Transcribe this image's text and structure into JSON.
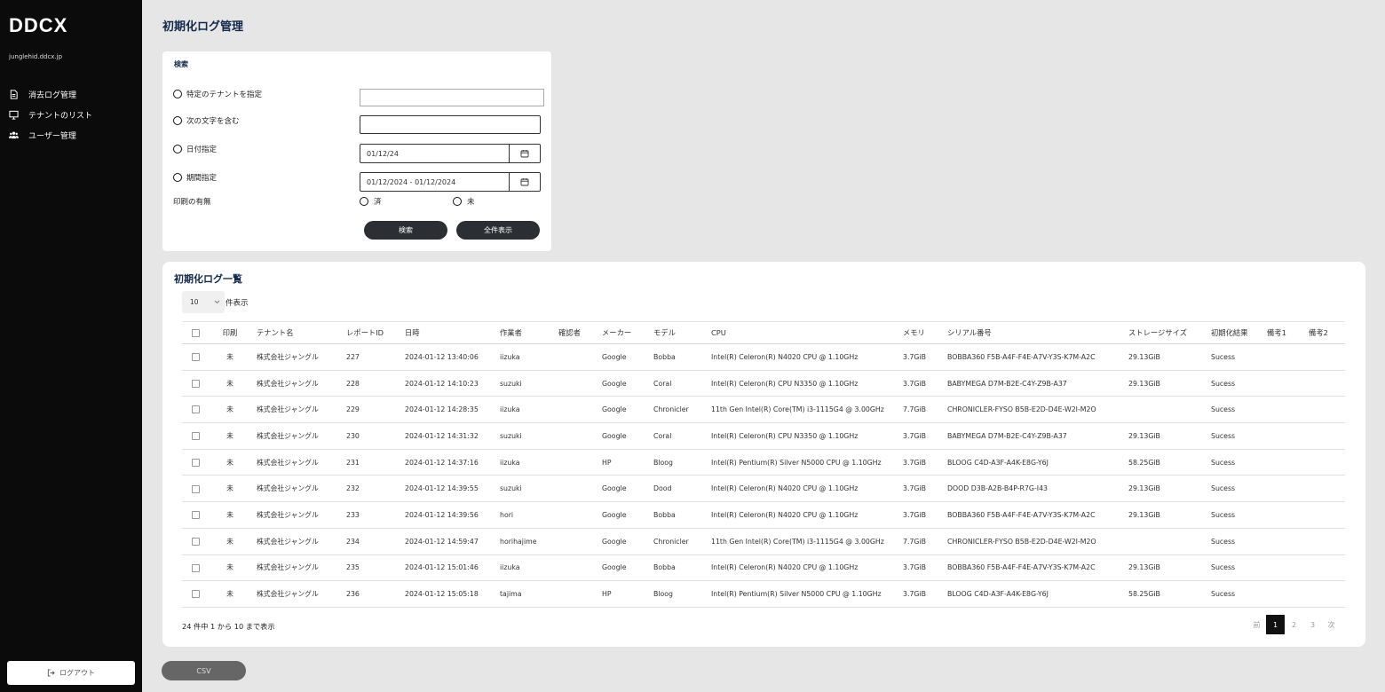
{
  "sidebar": {
    "logo": "DDCX",
    "email": "junglehid.ddcx.jp",
    "items": [
      {
        "label": "消去ログ管理",
        "icon": "document-icon"
      },
      {
        "label": "テナントのリスト",
        "icon": "monitor-icon"
      },
      {
        "label": "ユーザー管理",
        "icon": "users-icon"
      }
    ],
    "logout_label": "ログアウト"
  },
  "page_title": "初期化ログ管理",
  "search": {
    "heading": "検索",
    "options": {
      "tenant": "特定のテナントを指定",
      "contains": "次の文字を含む",
      "date": "日付指定",
      "period": "期間指定"
    },
    "tenant_value": "",
    "contains_value": "",
    "date_value": "01/12/24",
    "period_value": "01/12/2024 - 01/12/2024",
    "print_label": "印刷の有無",
    "print_done": "済",
    "print_not": "未",
    "search_button": "検索",
    "show_all_button": "全件表示"
  },
  "list": {
    "title": "初期化ログ一覧",
    "per_page": "10",
    "per_page_label": "件表示",
    "columns": [
      "印刷",
      "テナント名",
      "レポートID",
      "日時",
      "作業者",
      "確認者",
      "メーカー",
      "モデル",
      "CPU",
      "メモリ",
      "シリアル番号",
      "ストレージサイズ",
      "初期化結果",
      "備考1",
      "備考2"
    ],
    "rows": [
      [
        "未",
        "株式会社ジャングル",
        "227",
        "2024-01-12 13:40:06",
        "iizuka",
        "",
        "Google",
        "Bobba",
        "Intel(R) Celeron(R) N4020 CPU @ 1.10GHz",
        "3.7GiB",
        "BOBBA360 F5B-A4F-F4E-A7V-Y3S-K7M-A2C",
        "29.13GiB",
        "Sucess",
        "",
        ""
      ],
      [
        "未",
        "株式会社ジャングル",
        "228",
        "2024-01-12 14:10:23",
        "suzuki",
        "",
        "Google",
        "Coral",
        "Intel(R) Celeron(R) CPU N3350 @ 1.10GHz",
        "3.7GiB",
        "BABYMEGA D7M-B2E-C4Y-Z9B-A37",
        "29.13GiB",
        "Sucess",
        "",
        ""
      ],
      [
        "未",
        "株式会社ジャングル",
        "229",
        "2024-01-12 14:28:35",
        "iizuka",
        "",
        "Google",
        "Chronicler",
        "11th Gen Intel(R) Core(TM) i3-1115G4 @ 3.00GHz",
        "7.7GiB",
        "CHRONICLER-FYSO B5B-E2D-D4E-W2I-M2O",
        "",
        "Sucess",
        "",
        ""
      ],
      [
        "未",
        "株式会社ジャングル",
        "230",
        "2024-01-12 14:31:32",
        "suzuki",
        "",
        "Google",
        "Coral",
        "Intel(R) Celeron(R) CPU N3350 @ 1.10GHz",
        "3.7GiB",
        "BABYMEGA D7M-B2E-C4Y-Z9B-A37",
        "29.13GiB",
        "Sucess",
        "",
        ""
      ],
      [
        "未",
        "株式会社ジャングル",
        "231",
        "2024-01-12 14:37:16",
        "iizuka",
        "",
        "HP",
        "Bloog",
        "Intel(R) Pentium(R) Silver N5000 CPU @ 1.10GHz",
        "3.7GiB",
        "BLOOG C4D-A3F-A4K-E8G-Y6J",
        "58.25GiB",
        "Sucess",
        "",
        ""
      ],
      [
        "未",
        "株式会社ジャングル",
        "232",
        "2024-01-12 14:39:55",
        "suzuki",
        "",
        "Google",
        "Dood",
        "Intel(R) Celeron(R) N4020 CPU @ 1.10GHz",
        "3.7GiB",
        "DOOD D3B-A2B-B4P-R7G-I43",
        "29.13GiB",
        "Sucess",
        "",
        ""
      ],
      [
        "未",
        "株式会社ジャングル",
        "233",
        "2024-01-12 14:39:56",
        "hori",
        "",
        "Google",
        "Bobba",
        "Intel(R) Celeron(R) N4020 CPU @ 1.10GHz",
        "3.7GiB",
        "BOBBA360 F5B-A4F-F4E-A7V-Y3S-K7M-A2C",
        "29.13GiB",
        "Sucess",
        "",
        ""
      ],
      [
        "未",
        "株式会社ジャングル",
        "234",
        "2024-01-12 14:59:47",
        "horihajime",
        "",
        "Google",
        "Chronicler",
        "11th Gen Intel(R) Core(TM) i3-1115G4 @ 3.00GHz",
        "7.7GiB",
        "CHRONICLER-FYSO B5B-E2D-D4E-W2I-M2O",
        "",
        "Sucess",
        "",
        ""
      ],
      [
        "未",
        "株式会社ジャングル",
        "235",
        "2024-01-12 15:01:46",
        "iizuka",
        "",
        "Google",
        "Bobba",
        "Intel(R) Celeron(R) N4020 CPU @ 1.10GHz",
        "3.7GiB",
        "BOBBA360 F5B-A4F-F4E-A7V-Y3S-K7M-A2C",
        "29.13GiB",
        "Sucess",
        "",
        ""
      ],
      [
        "未",
        "株式会社ジャングル",
        "236",
        "2024-01-12 15:05:18",
        "tajima",
        "",
        "HP",
        "Bloog",
        "Intel(R) Pentium(R) Silver N5000 CPU @ 1.10GHz",
        "3.7GiB",
        "BLOOG C4D-A3F-A4K-E8G-Y6J",
        "58.25GiB",
        "Sucess",
        "",
        ""
      ]
    ],
    "summary": "24 件中 1 から 10 まで表示",
    "pagination": {
      "prev": "前",
      "pages": [
        "1",
        "2",
        "3"
      ],
      "next": "次",
      "current": "1"
    }
  },
  "csv_button": "CSV",
  "colors": {
    "sidebar_bg": "#0b0b0b",
    "title": "#14284b",
    "button_dark": "#2b2f33",
    "page_bg": "#e6e6e6"
  }
}
